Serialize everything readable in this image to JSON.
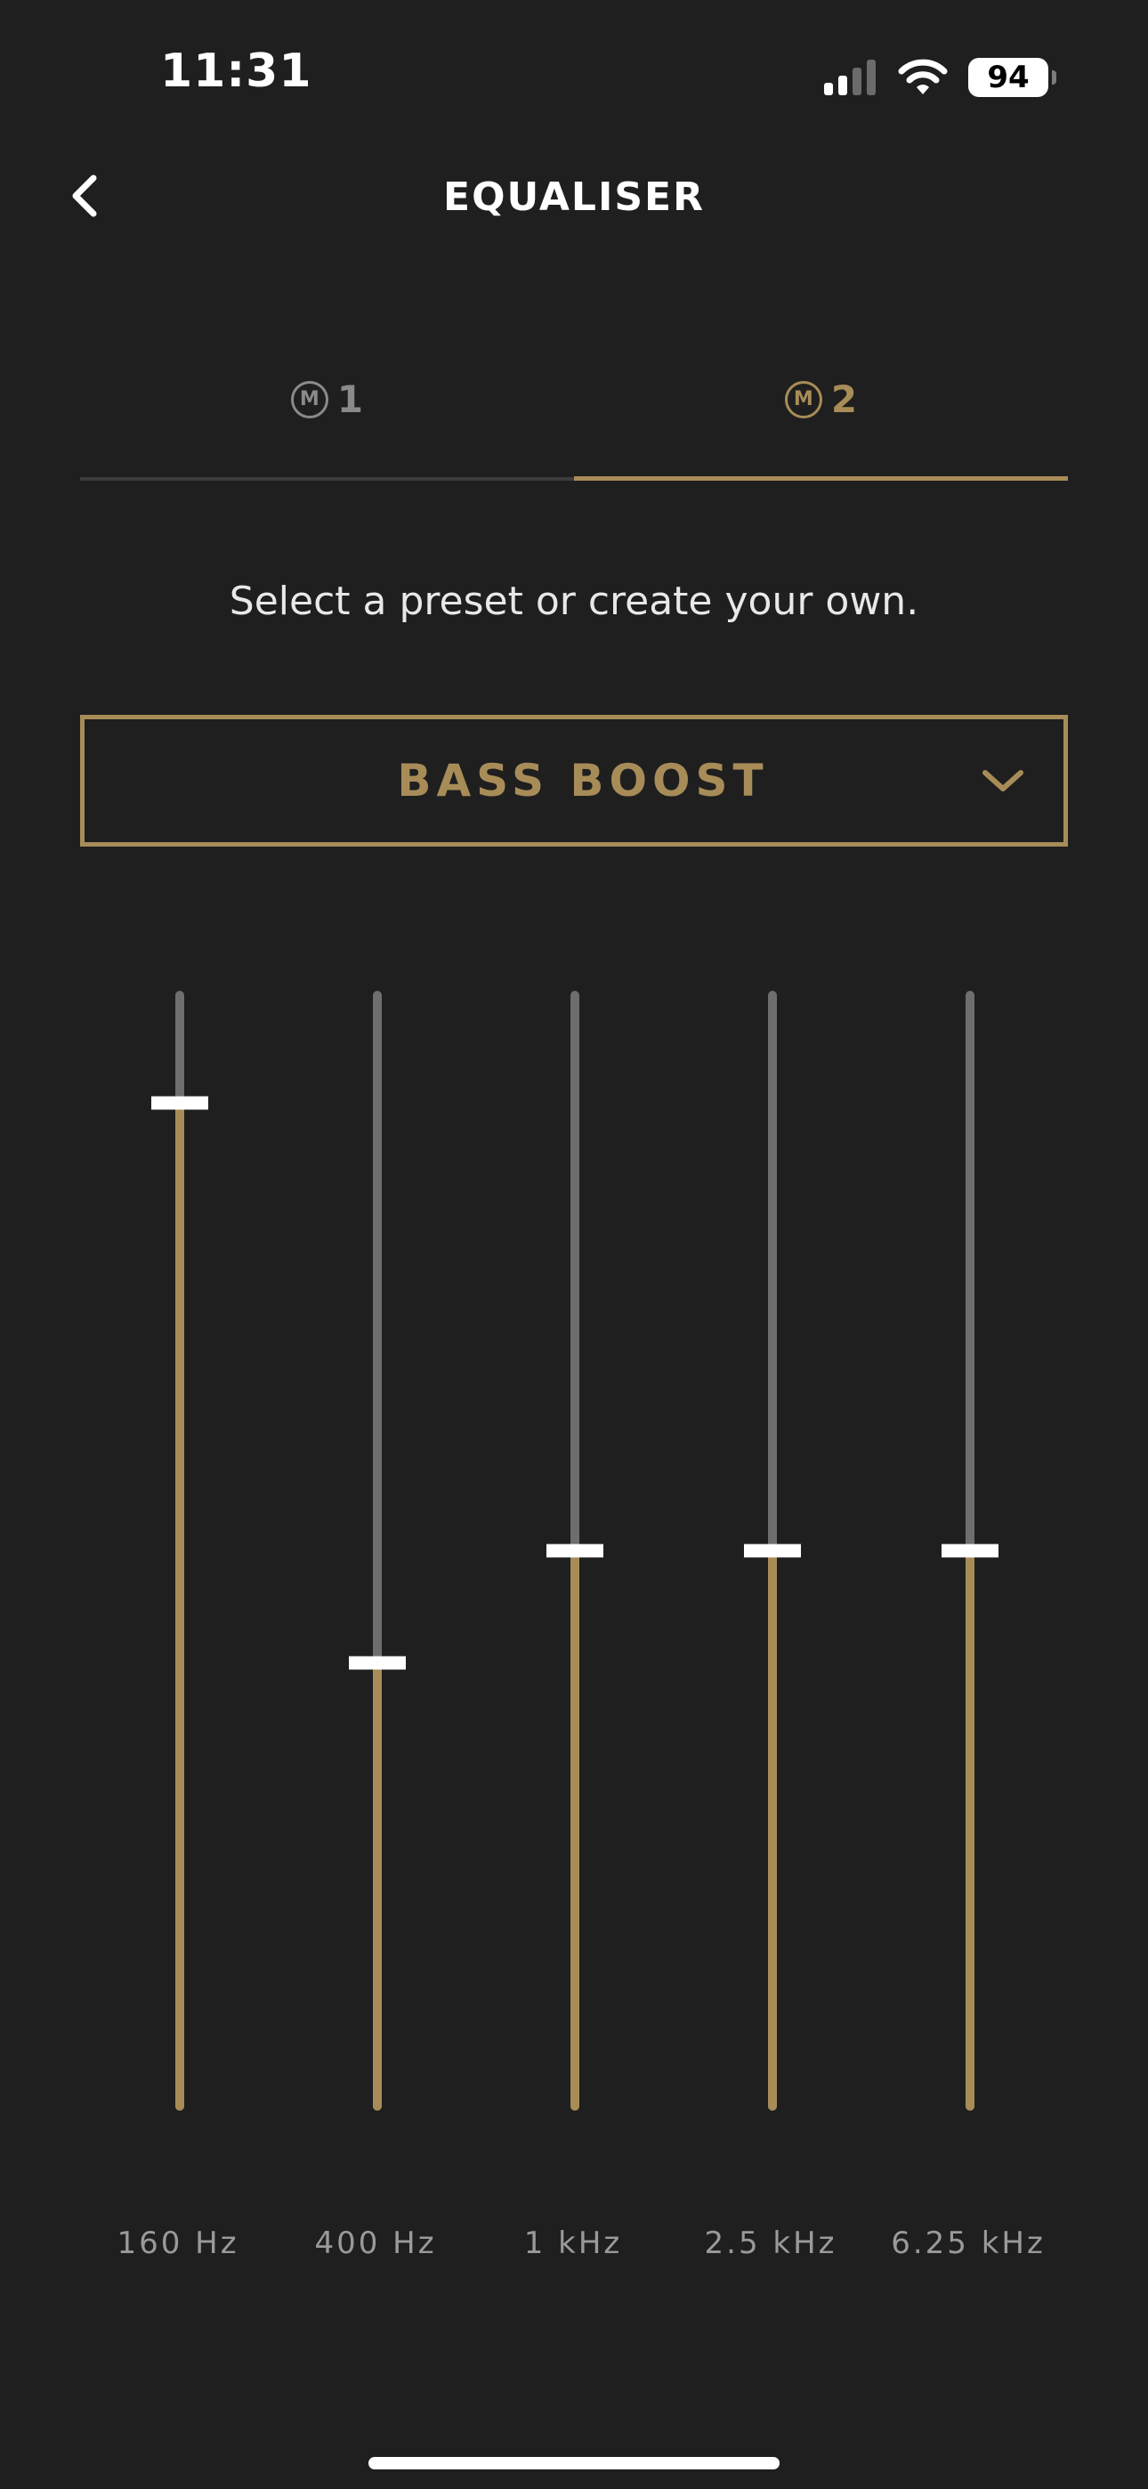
{
  "status_bar": {
    "time": "11:31",
    "battery": "94",
    "icons": [
      "signal-icon",
      "wifi-icon",
      "battery-icon"
    ]
  },
  "header": {
    "title": "EQUALISER",
    "back_icon": "chevron-left-icon"
  },
  "tabs": [
    {
      "badge": "M",
      "label": "1",
      "active": false
    },
    {
      "badge": "M",
      "label": "2",
      "active": true
    }
  ],
  "instruction": "Select a preset or create your own.",
  "preset": {
    "selected": "BASS BOOST",
    "icon": "chevron-down-icon"
  },
  "equaliser": {
    "bands": [
      {
        "label": "160 Hz",
        "level": 0.9
      },
      {
        "label": "400 Hz",
        "level": 0.4
      },
      {
        "label": "1 kHz",
        "level": 0.5
      },
      {
        "label": "2.5 kHz",
        "level": 0.5
      },
      {
        "label": "6.25 kHz",
        "level": 0.5
      }
    ]
  },
  "colors": {
    "background": "#1f1f1f",
    "accent": "#a88c58",
    "track": "#6e6e6e",
    "handle": "#ffffff",
    "inactive_text": "#8a8a8a"
  }
}
